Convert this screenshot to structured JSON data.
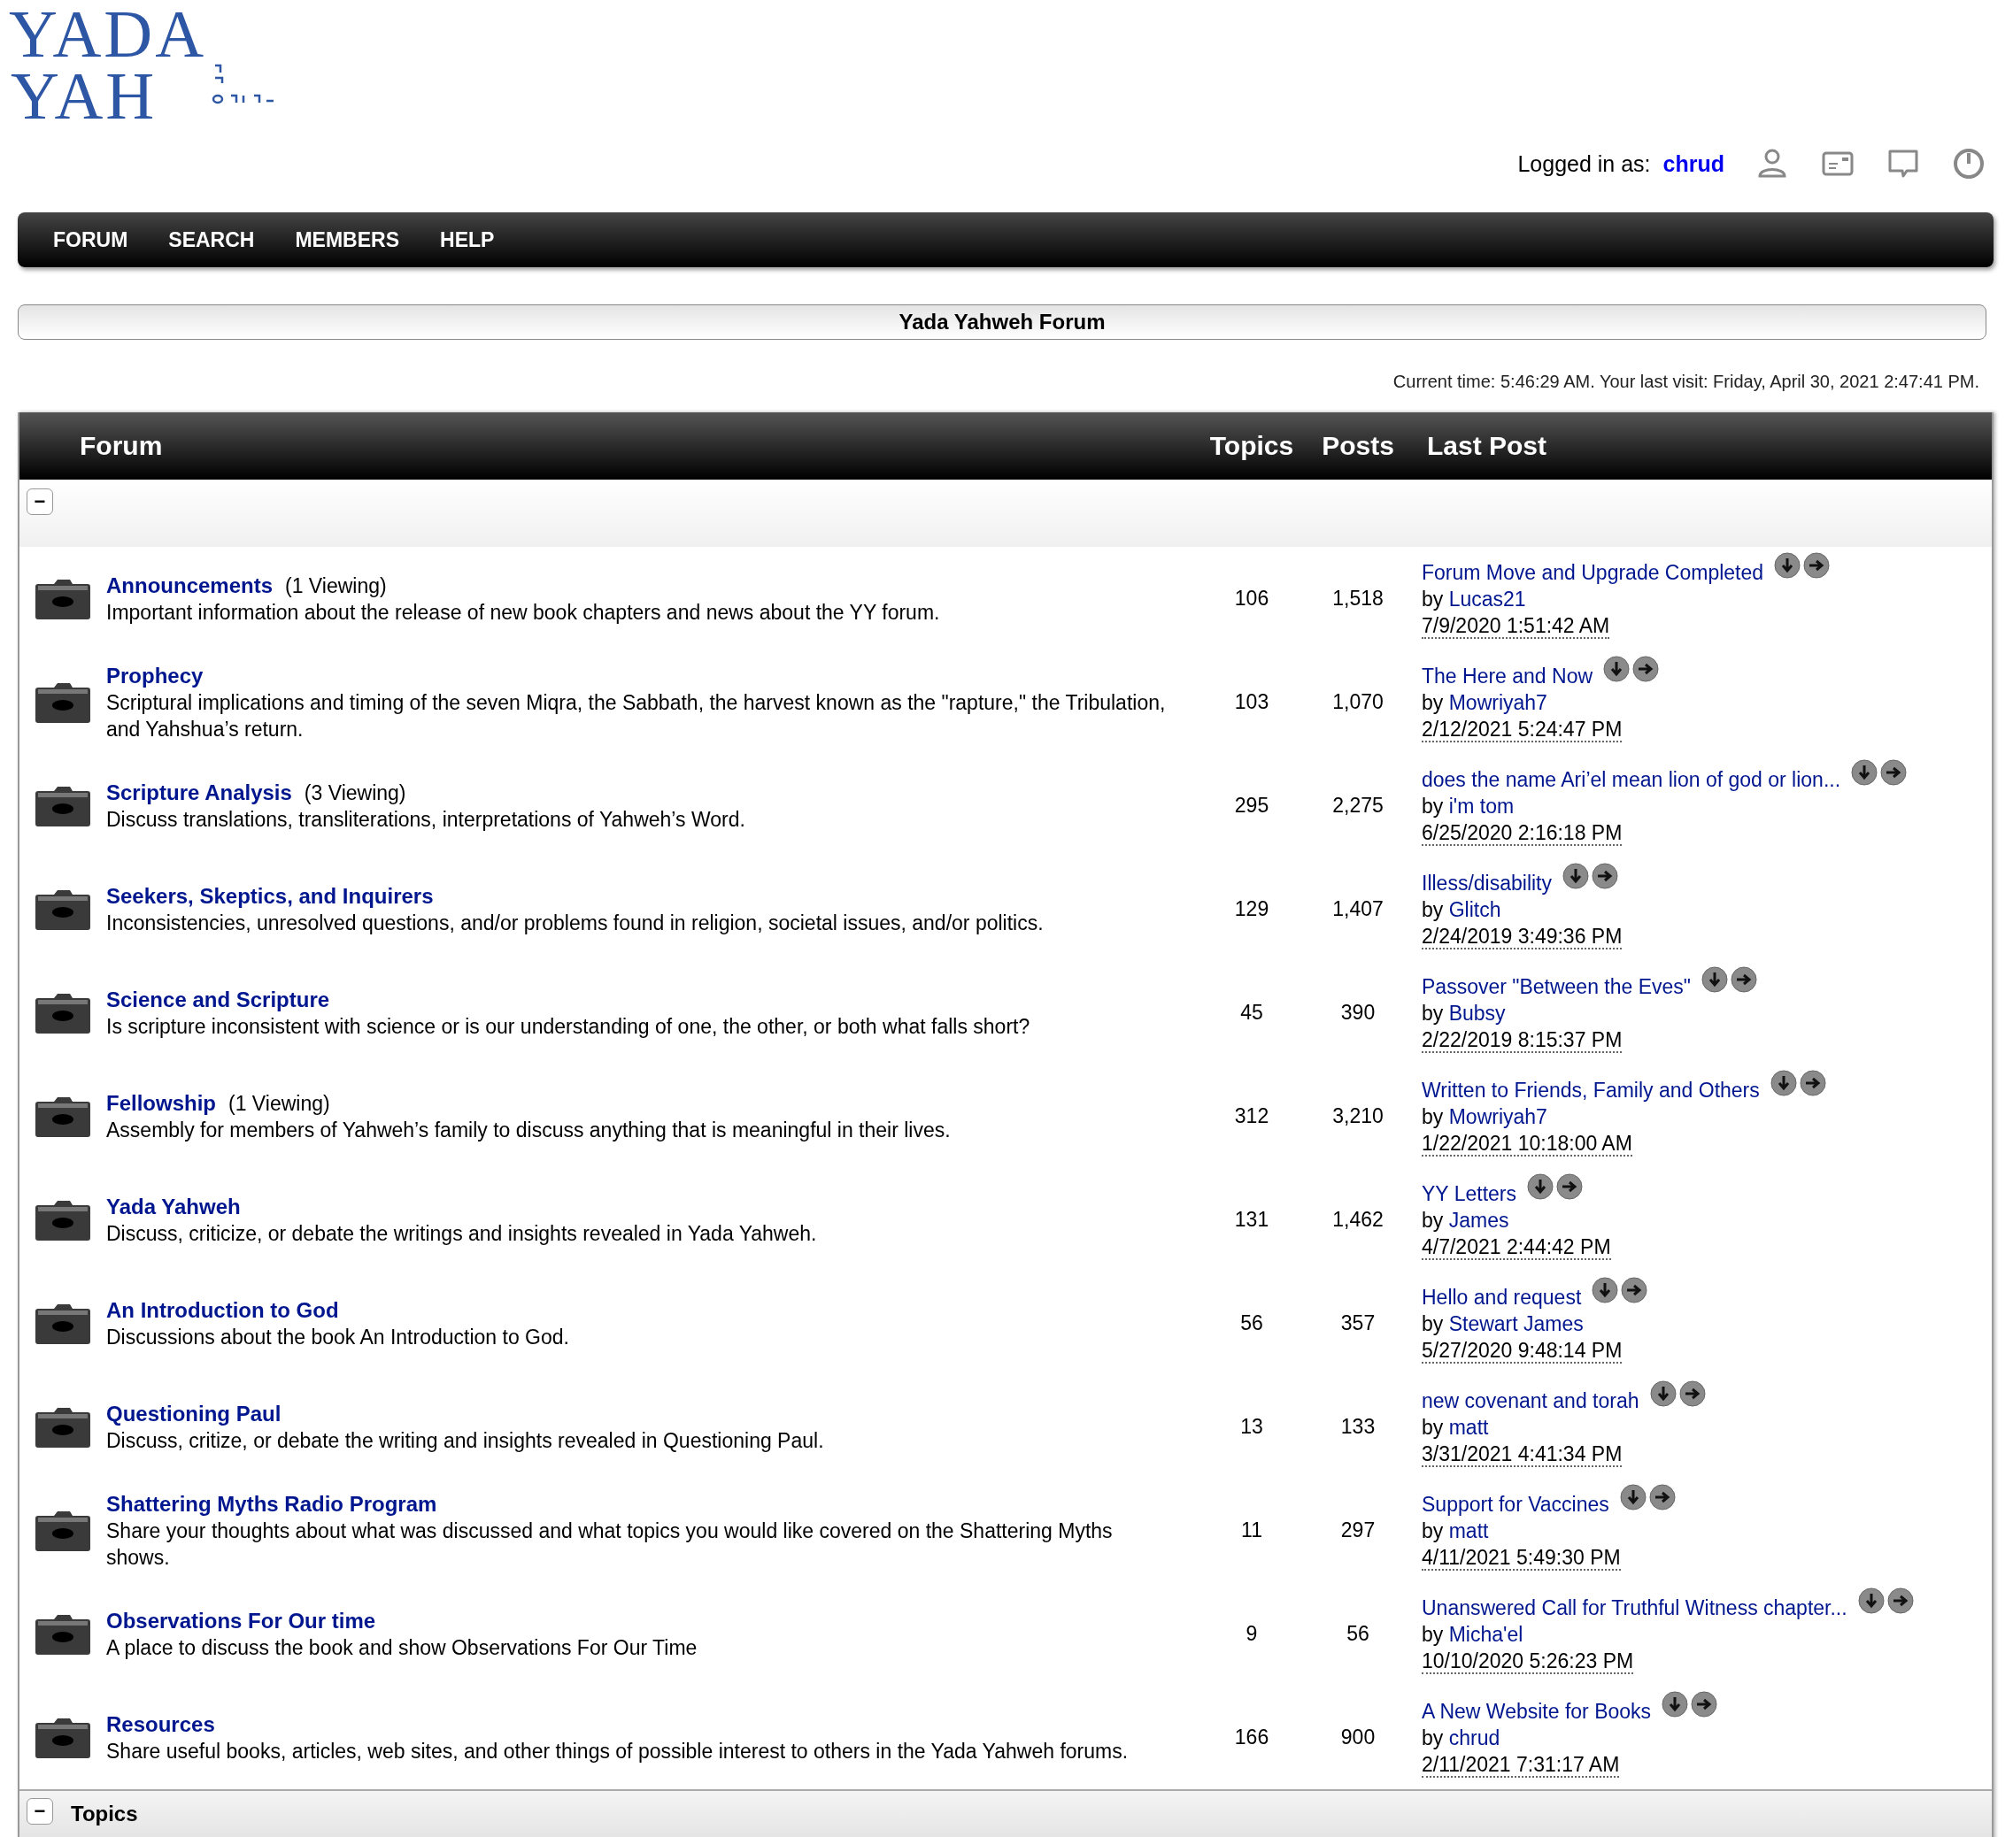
{
  "logo": {
    "line1": "YADA",
    "line2": "YAH"
  },
  "user_bar": {
    "label": "Logged in as:",
    "username": "chrud"
  },
  "nav": [
    "FORUM",
    "SEARCH",
    "MEMBERS",
    "HELP"
  ],
  "title_bar": "Yada Yahweh Forum",
  "time_info": "Current time: 5:46:29 AM. Your last visit: Friday, April 30, 2021 2:47:41 PM.",
  "table": {
    "columns": [
      "Forum",
      "Topics",
      "Posts",
      "Last Post"
    ],
    "collapse": "−",
    "rows": [
      {
        "name": "Announcements",
        "viewing": "(1 Viewing)",
        "description": "Important information about the release of new book chapters and news about the YY forum.",
        "topics": "106",
        "posts": "1,518",
        "last_post": {
          "title": "Forum Move and Upgrade Completed",
          "by": "by",
          "author": "Lucas21",
          "date": "7/9/2020 1:51:42 AM"
        }
      },
      {
        "name": "Prophecy",
        "description": "Scriptural implications and timing of the seven Miqra, the Sabbath, the harvest known as the \"rapture,\" the Tribulation, and Yahshua’s return.",
        "topics": "103",
        "posts": "1,070",
        "last_post": {
          "title": "The Here and Now",
          "by": "by",
          "author": "Mowriyah7",
          "date": "2/12/2021 5:24:47 PM"
        }
      },
      {
        "name": "Scripture Analysis",
        "viewing": "(3 Viewing)",
        "description": "Discuss translations, transliterations, interpretations of Yahweh’s Word.",
        "topics": "295",
        "posts": "2,275",
        "last_post": {
          "title": "does the name Ari’el mean lion of god or lion...",
          "by": "by",
          "author": "i'm tom",
          "date": "6/25/2020 2:16:18 PM"
        }
      },
      {
        "name": "Seekers, Skeptics, and Inquirers",
        "description": "Inconsistencies, unresolved questions, and/or problems found in religion, societal issues, and/or politics.",
        "topics": "129",
        "posts": "1,407",
        "last_post": {
          "title": "Illess/disability",
          "by": "by",
          "author": "Glitch",
          "date": "2/24/2019 3:49:36 PM"
        }
      },
      {
        "name": "Science and Scripture",
        "description": "Is scripture inconsistent with science or is our understanding of one, the other, or both what falls short?",
        "topics": "45",
        "posts": "390",
        "last_post": {
          "title": "Passover \"Between the Eves\"",
          "by": "by",
          "author": "Bubsy",
          "date": "2/22/2019 8:15:37 PM"
        }
      },
      {
        "name": "Fellowship",
        "viewing": "(1 Viewing)",
        "description": "Assembly for members of Yahweh’s family to discuss anything that is meaningful in their lives.",
        "topics": "312",
        "posts": "3,210",
        "last_post": {
          "title": "Written to Friends, Family and Others",
          "by": "by",
          "author": "Mowriyah7",
          "date": "1/22/2021 10:18:00 AM"
        }
      },
      {
        "name": "Yada Yahweh",
        "description": "Discuss, criticize, or debate the writings and insights revealed in Yada Yahweh.",
        "topics": "131",
        "posts": "1,462",
        "last_post": {
          "title": "YY Letters",
          "by": "by",
          "author": "James",
          "date": "4/7/2021 2:44:42 PM"
        }
      },
      {
        "name": "An Introduction to God",
        "description": "Discussions about the book An Introduction to God.",
        "topics": "56",
        "posts": "357",
        "last_post": {
          "title": "Hello and request",
          "by": "by",
          "author": "Stewart James",
          "date": "5/27/2020 9:48:14 PM"
        }
      },
      {
        "name": "Questioning Paul",
        "description": "Discuss, critize, or debate the writing and insights revealed in Questioning Paul.",
        "topics": "13",
        "posts": "133",
        "last_post": {
          "title": "new covenant and torah",
          "by": "by",
          "author": "matt",
          "date": "3/31/2021 4:41:34 PM"
        }
      },
      {
        "name": "Shattering Myths Radio Program",
        "description": "Share your thoughts about what was discussed and what topics you would like covered on the Shattering Myths shows.",
        "topics": "11",
        "posts": "297",
        "last_post": {
          "title": "Support for Vaccines",
          "by": "by",
          "author": "matt",
          "date": "4/11/2021 5:49:30 PM"
        }
      },
      {
        "name": "Observations For Our time",
        "description": "A place to discuss the book and show Observations For Our Time",
        "topics": "9",
        "posts": "56",
        "last_post": {
          "title": "Unanswered Call for Truthful Witness chapter...",
          "by": "by",
          "author": "Micha'el",
          "date": "10/10/2020 5:26:23 PM"
        }
      },
      {
        "name": "Resources",
        "description": "Share useful books, articles, web sites, and other things of possible interest to others in the Yada Yahweh forums.",
        "topics": "166",
        "posts": "900",
        "last_post": {
          "title": "A New Website for Books",
          "by": "by",
          "author": "chrud",
          "date": "2/11/2021 7:31:17 AM"
        }
      }
    ]
  },
  "topics_section": {
    "collapse": "−",
    "title": "Topics"
  }
}
